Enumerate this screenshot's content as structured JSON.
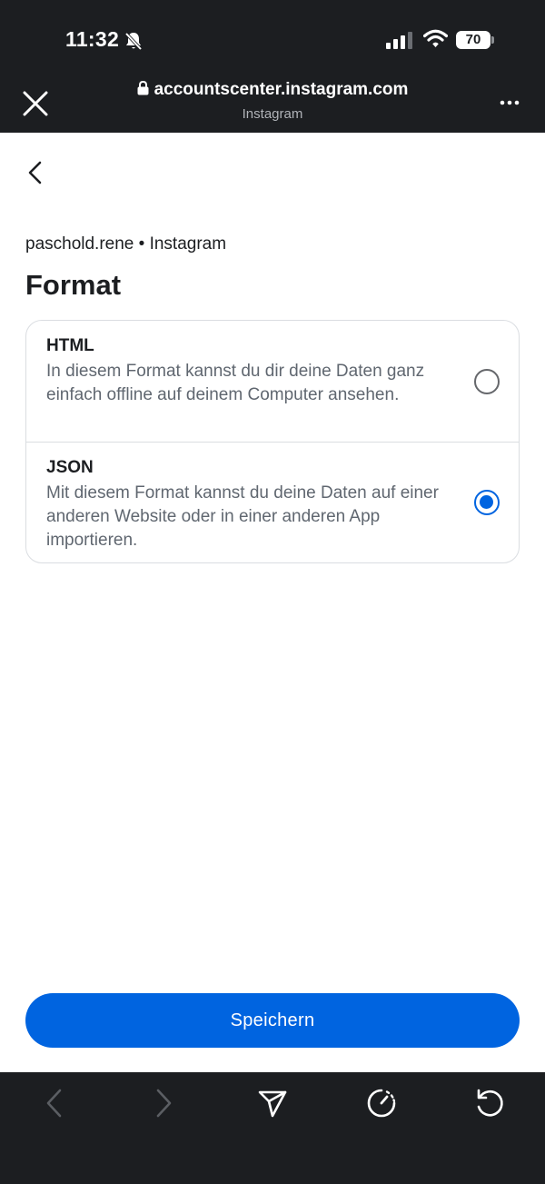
{
  "status_bar": {
    "time": "11:32",
    "battery": "70"
  },
  "browser": {
    "url": "accountscenter.instagram.com",
    "site_name": "Instagram"
  },
  "account_line": "paschold.rene • Instagram",
  "title": "Format",
  "options": [
    {
      "label": "HTML",
      "description": "In diesem Format kannst du dir deine Daten ganz einfach offline auf deinem Computer ansehen.",
      "selected": false
    },
    {
      "label": "JSON",
      "description": "Mit diesem Format kannst du deine Daten auf einer anderen Website oder in einer anderen App importieren.",
      "selected": true
    }
  ],
  "save_label": "Speichern",
  "colors": {
    "accent": "#0064e0",
    "chrome": "#1c1e21",
    "text": "#1c1e21",
    "secondary_text": "#606770"
  },
  "icons": {
    "status": [
      "silent-bell-icon",
      "signal-icon",
      "wifi-icon",
      "battery-icon"
    ],
    "header": [
      "close-icon",
      "lock-icon",
      "more-icon"
    ],
    "content": [
      "back-chevron-icon"
    ],
    "toolbar": [
      "back-arrow-icon",
      "forward-arrow-icon",
      "share-icon",
      "speed-icon",
      "refresh-icon"
    ]
  }
}
